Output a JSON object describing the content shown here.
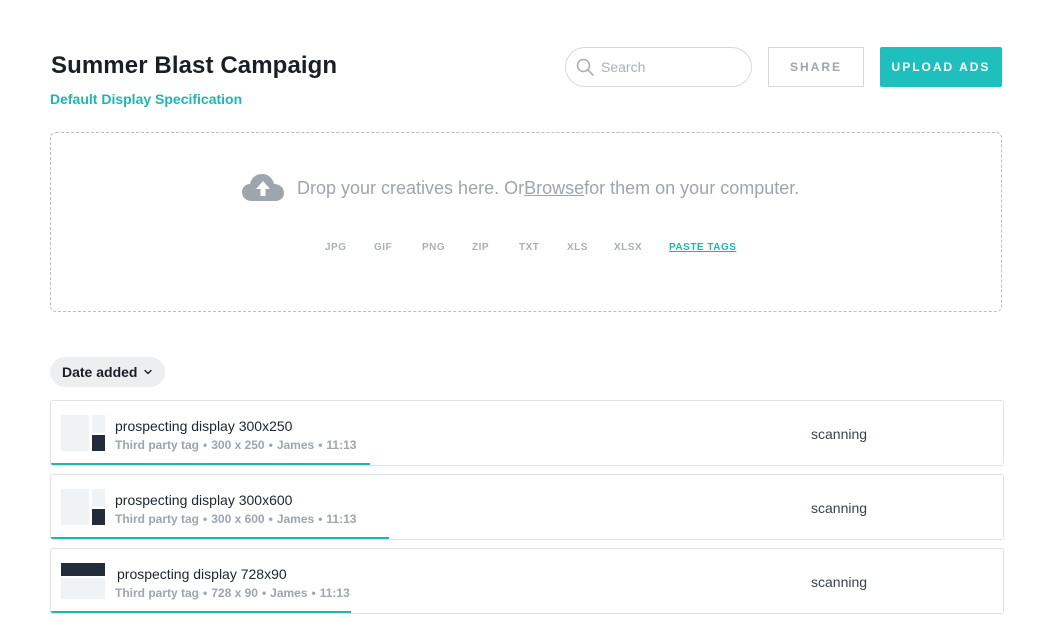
{
  "header": {
    "title": "Summer Blast Campaign",
    "subtitle": "Default Display Specification",
    "search_placeholder": "Search",
    "share_label": "SHARE",
    "upload_label": "UPLOAD ADS"
  },
  "dropzone": {
    "text_before": "Drop your creatives here. Or ",
    "browse_link": "Browse",
    "text_after": " for them on your computer.",
    "filetypes": [
      "JPG",
      "GIF",
      "PNG",
      "ZIP",
      "TXT",
      "XLS",
      "XLSX"
    ],
    "paste_tags_label": "PASTE TAGS"
  },
  "sort": {
    "label": "Date added"
  },
  "ads": [
    {
      "name": "prospecting display 300x250",
      "type": "Third party tag",
      "size": "300 x 250",
      "user": "James",
      "time": "11:13",
      "status": "scanning",
      "progress": 0.335
    },
    {
      "name": "prospecting display 300x600",
      "type": "Third party tag",
      "size": "300 x 600",
      "user": "James",
      "time": "11:13",
      "status": "scanning",
      "progress": 0.355
    },
    {
      "name": "prospecting display 728x90",
      "type": "Third party tag",
      "size": "728 x 90",
      "user": "James",
      "time": "11:13",
      "status": "scanning",
      "progress": 0.315
    }
  ],
  "colors": {
    "accent": "#1fbfbd",
    "accent_text": "#1fb5b0",
    "thumb_dark": "#222d39",
    "thumb_light": "#f0f3f5"
  },
  "icons": {
    "search": "search-icon",
    "upload": "cloud-upload-icon",
    "chevron": "chevron-down-icon"
  }
}
